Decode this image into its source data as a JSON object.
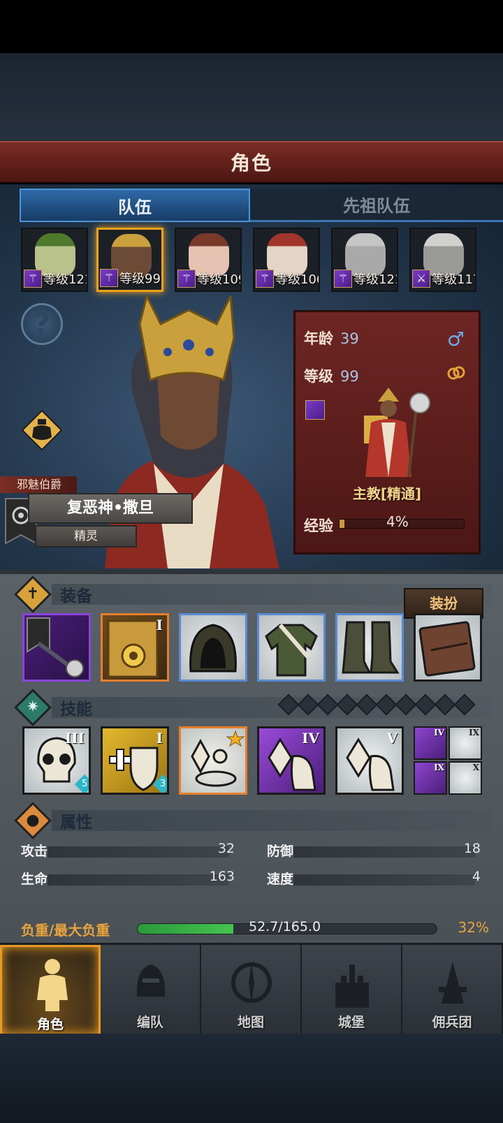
{
  "header": {
    "title": "角色"
  },
  "tabs": [
    {
      "label": "队伍"
    },
    {
      "label": "先祖队伍"
    }
  ],
  "party": [
    {
      "level": "等级121",
      "face_color": "#b8c28a",
      "headwear": "#4f7a2c"
    },
    {
      "level": "等级99",
      "face_color": "#6b4a36",
      "headwear": "#c9a03c"
    },
    {
      "level": "等级109",
      "face_color": "#e6c2b2",
      "headwear": "#7a3a2a"
    },
    {
      "level": "等级106",
      "face_color": "#e3d4c6",
      "headwear": "#a3362c"
    },
    {
      "level": "等级121",
      "face_color": "#a9a9a9",
      "headwear": "#c5c5c5"
    },
    {
      "level": "等级117",
      "face_color": "#9a9a96",
      "headwear": "#d0d0cc"
    }
  ],
  "hero": {
    "class_tag": "邪魅伯爵",
    "name": "复恶神•撒旦",
    "race": "精灵",
    "age_label": "年龄",
    "age": "39",
    "level_label": "等级",
    "level": "99",
    "sex_symbol": "♂",
    "class_name": "主教[精通]",
    "exp_label": "经验",
    "exp": "4%",
    "exp_fraction": 0.04
  },
  "equipment": {
    "title": "装备",
    "dress_button": "装扮",
    "roman_slot2": "I"
  },
  "skills": {
    "title": "技能",
    "big": [
      {
        "roman": "III",
        "badge": "5",
        "icon": "skull-icon"
      },
      {
        "roman": "I",
        "badge": "3",
        "icon": "holy-shield-icon"
      },
      {
        "roman": "",
        "badge": "",
        "icon": "crystal-prayer-icon"
      },
      {
        "roman": "IV",
        "badge": "",
        "icon": "crystal-hand-icon"
      },
      {
        "roman": "V",
        "badge": "",
        "icon": "crystal-hand-icon"
      }
    ],
    "mini": [
      "IV",
      "IX",
      "IX",
      "X"
    ]
  },
  "attributes": {
    "title": "属性",
    "attack_label": "攻击",
    "attack": "32",
    "defense_label": "防御",
    "defense": "18",
    "hp_label": "生命",
    "hp": "163",
    "speed_label": "速度",
    "speed": "4",
    "weight_label": "负重/最大负重",
    "weight": "52.7/165.0",
    "weight_pct": "32%",
    "weight_fraction": 0.32
  },
  "nav": [
    {
      "label": "角色",
      "icon": "knight-icon"
    },
    {
      "label": "编队",
      "icon": "helmet-icon"
    },
    {
      "label": "地图",
      "icon": "compass-icon"
    },
    {
      "label": "城堡",
      "icon": "castle-icon"
    },
    {
      "label": "佣兵团",
      "icon": "mercenary-icon"
    }
  ],
  "colors": {
    "accent": "#e89a24",
    "tab_blue": "#2f6aa8",
    "title_red": "#7a2c25"
  }
}
